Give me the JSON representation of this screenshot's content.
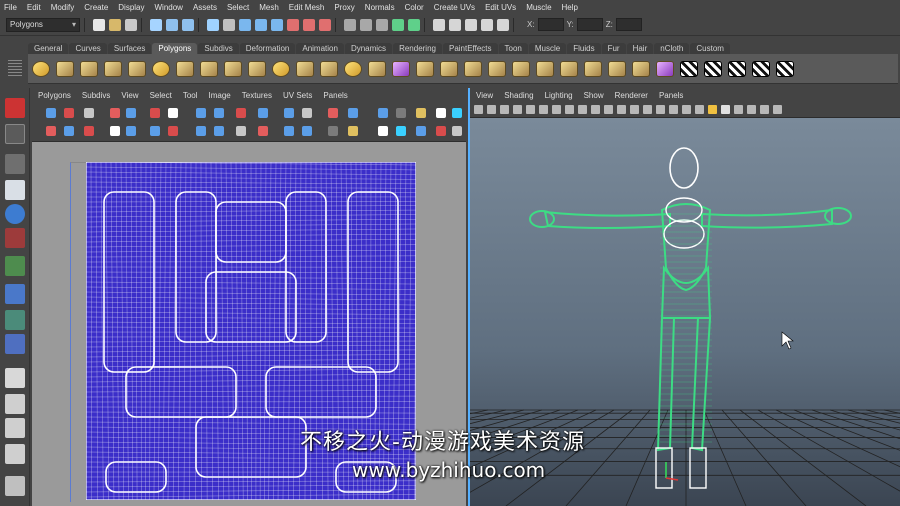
{
  "menubar": {
    "items": [
      "File",
      "Edit",
      "Modify",
      "Create",
      "Display",
      "Window",
      "Assets",
      "Select",
      "Mesh",
      "Edit Mesh",
      "Proxy",
      "Normals",
      "Color",
      "Create UVs",
      "Edit UVs",
      "Muscle",
      "Help"
    ]
  },
  "statusline": {
    "mode_value": "Polygons",
    "x_label": "X:",
    "y_label": "Y:",
    "z_label": "Z:"
  },
  "shelf": {
    "tabs": [
      "General",
      "Curves",
      "Surfaces",
      "Polygons",
      "Subdivs",
      "Deformation",
      "Animation",
      "Dynamics",
      "Rendering",
      "PaintEffects",
      "Toon",
      "Muscle",
      "Fluids",
      "Fur",
      "Hair",
      "nCloth",
      "Custom"
    ],
    "active_tab": "Polygons"
  },
  "uv_editor": {
    "menu": [
      "Polygons",
      "Subdivs",
      "View",
      "Select",
      "Tool",
      "Image",
      "Textures",
      "UV Sets",
      "Panels"
    ],
    "wire_color": "#ffffff",
    "fill_color": "#3b2ec9"
  },
  "perspective": {
    "menu": [
      "View",
      "Shading",
      "Lighting",
      "Show",
      "Renderer",
      "Panels"
    ],
    "model_color": "#3ddc84",
    "head_color": "#ffffff"
  },
  "watermark": {
    "line1": "不移之火-动漫游戏美术资源",
    "line2": "www.byzhihuo.com"
  },
  "colors": {
    "ui_bg": "#444444",
    "viewport_bg": "#5e6f80",
    "selection_blue": "#55b0ff"
  }
}
